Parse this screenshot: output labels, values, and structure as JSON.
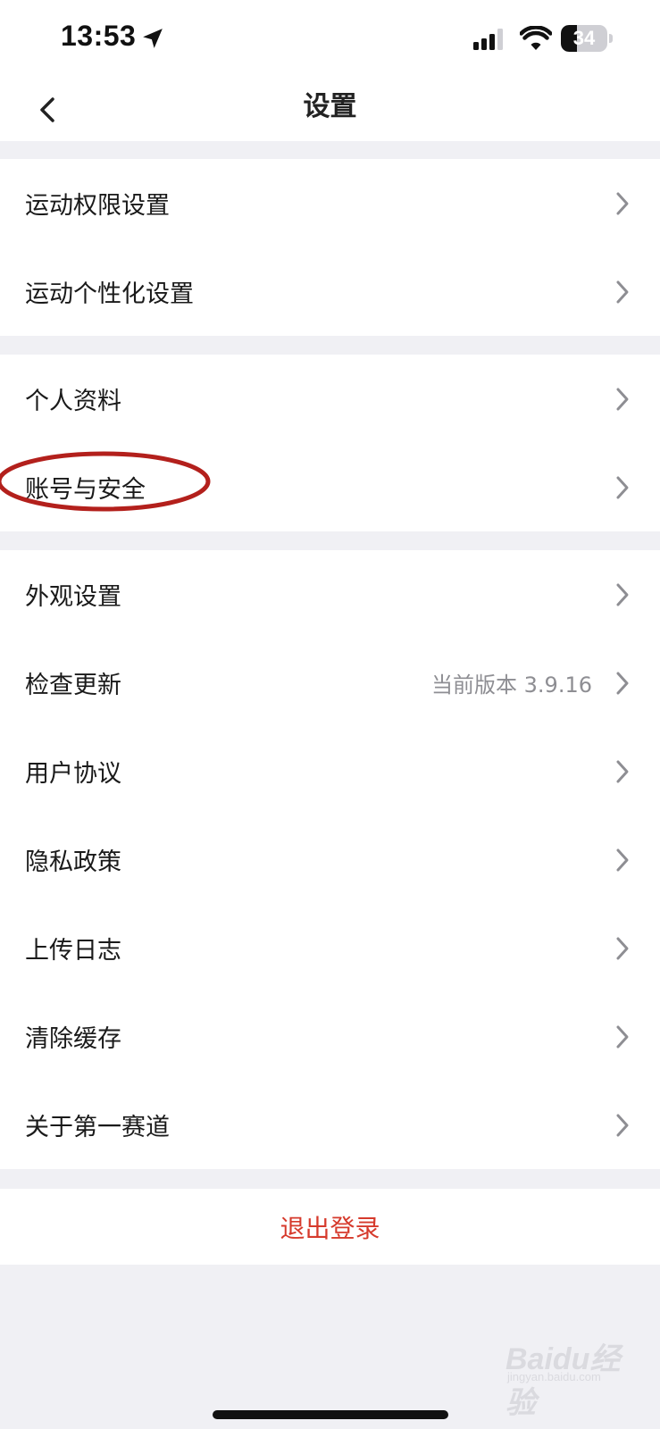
{
  "status_bar": {
    "time": "13:53",
    "battery_level": "34",
    "battery_fraction": 0.34
  },
  "nav": {
    "title": "设置"
  },
  "groups": [
    {
      "items": [
        {
          "label": "运动权限设置"
        },
        {
          "label": "运动个性化设置"
        }
      ]
    },
    {
      "items": [
        {
          "label": "个人资料"
        },
        {
          "label": "账号与安全"
        }
      ]
    },
    {
      "items": [
        {
          "label": "外观设置"
        },
        {
          "label": "检查更新",
          "value": "当前版本 3.9.16"
        },
        {
          "label": "用户协议"
        },
        {
          "label": "隐私政策"
        },
        {
          "label": "上传日志"
        },
        {
          "label": "清除缓存"
        },
        {
          "label": "关于第一赛道"
        }
      ]
    }
  ],
  "logout": {
    "label": "退出登录"
  },
  "watermark": {
    "brand": "Baidu经验",
    "sub": "jingyan.baidu.com"
  },
  "colors": {
    "background": "#f0f0f4",
    "logout_red": "#d63a2c",
    "annotation_red": "#b3201c",
    "secondary_text": "#8e8e93"
  }
}
